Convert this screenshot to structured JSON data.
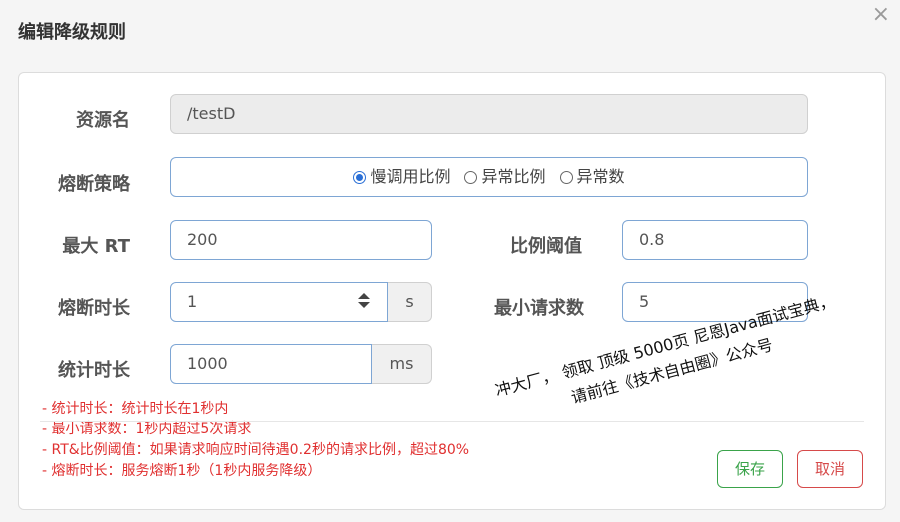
{
  "dialog": {
    "title": "编辑降级规则",
    "close": "×"
  },
  "form": {
    "resource": {
      "label": "资源名",
      "value": "/testD"
    },
    "strategy": {
      "label": "熔断策略",
      "options": [
        "慢调用比例",
        "异常比例",
        "异常数"
      ],
      "selected": "慢调用比例"
    },
    "max_rt": {
      "label": "最大 RT",
      "value": "200"
    },
    "ratio_threshold": {
      "label": "比例阈值",
      "value": "0.8"
    },
    "circuit_duration": {
      "label": "熔断时长",
      "value": "1",
      "unit": "s"
    },
    "min_requests": {
      "label": "最小请求数",
      "value": "5"
    },
    "stat_duration": {
      "label": "统计时长",
      "value": "1000",
      "unit": "ms"
    }
  },
  "help": [
    "- 统计时长：统计时长在1秒内",
    "- 最小请求数：1秒内超过5次请求",
    "- RT&比例阈值：如果请求响应时间待遇0.2秒的请求比例，超过80%",
    "- 熔断时长：服务熔断1秒（1秒内服务降级）"
  ],
  "buttons": {
    "save": "保存",
    "cancel": "取消"
  },
  "watermark": {
    "line1": "冲大厂， 领取 顶级 5000页 尼恩Java面试宝典，",
    "line2": "请前往《技术自由圈》公众号"
  },
  "colors": {
    "field_border": "#7ea6d4",
    "save": "#3aa34a",
    "cancel": "#d64a4a",
    "help": "#e03030"
  }
}
